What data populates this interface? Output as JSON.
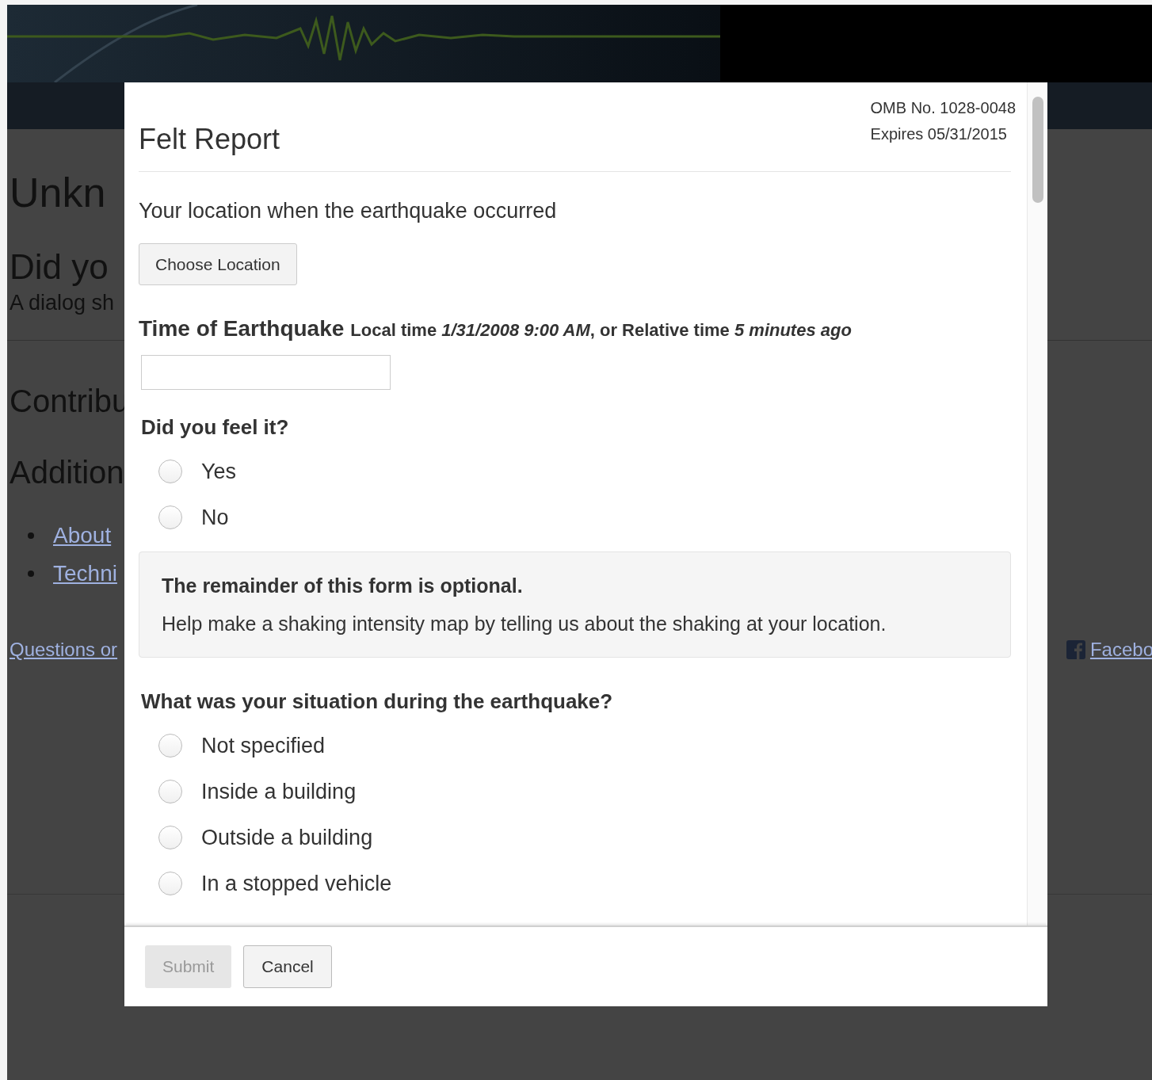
{
  "page": {
    "heading": "Unkn",
    "subheading": "Did yo",
    "intro": "A dialog sh",
    "section_1": "Contribu",
    "section_2": "Addition",
    "links": [
      "About",
      "Techni"
    ],
    "footer_link": "Questions or",
    "social_link": "Facebo"
  },
  "dialog": {
    "title": "Felt Report",
    "omb_number": "OMB No. 1028-0048",
    "expires": "Expires 05/31/2015",
    "location_label": "Your location when the earthquake occurred",
    "location_button": "Choose Location",
    "time_label": "Time of Earthquake",
    "time_hint": "Local time *1/31/2008 9:00 AM*, or Relative time *5 minutes ago*",
    "questions_before": [
      {
        "title": "Did you feel it?",
        "options": [
          {
            "label": "Yes",
            "selected": false
          },
          {
            "label": "No",
            "selected": false
          }
        ]
      }
    ],
    "notice": {
      "title": "The remainder of this form is optional.",
      "text": "Help make a shaking intensity map by telling us about the shaking at your location."
    },
    "questions_after": [
      {
        "title": "What was your situation during the earthquake?",
        "options": [
          {
            "label": "Not specified",
            "selected": false
          },
          {
            "label": "Inside a building",
            "selected": false
          },
          {
            "label": "Outside a building",
            "selected": false
          },
          {
            "label": "In a stopped vehicle",
            "selected": false
          }
        ]
      }
    ],
    "buttons": [
      {
        "label": "Submit",
        "disabled": true
      },
      {
        "label": "Cancel",
        "disabled": false
      }
    ]
  }
}
